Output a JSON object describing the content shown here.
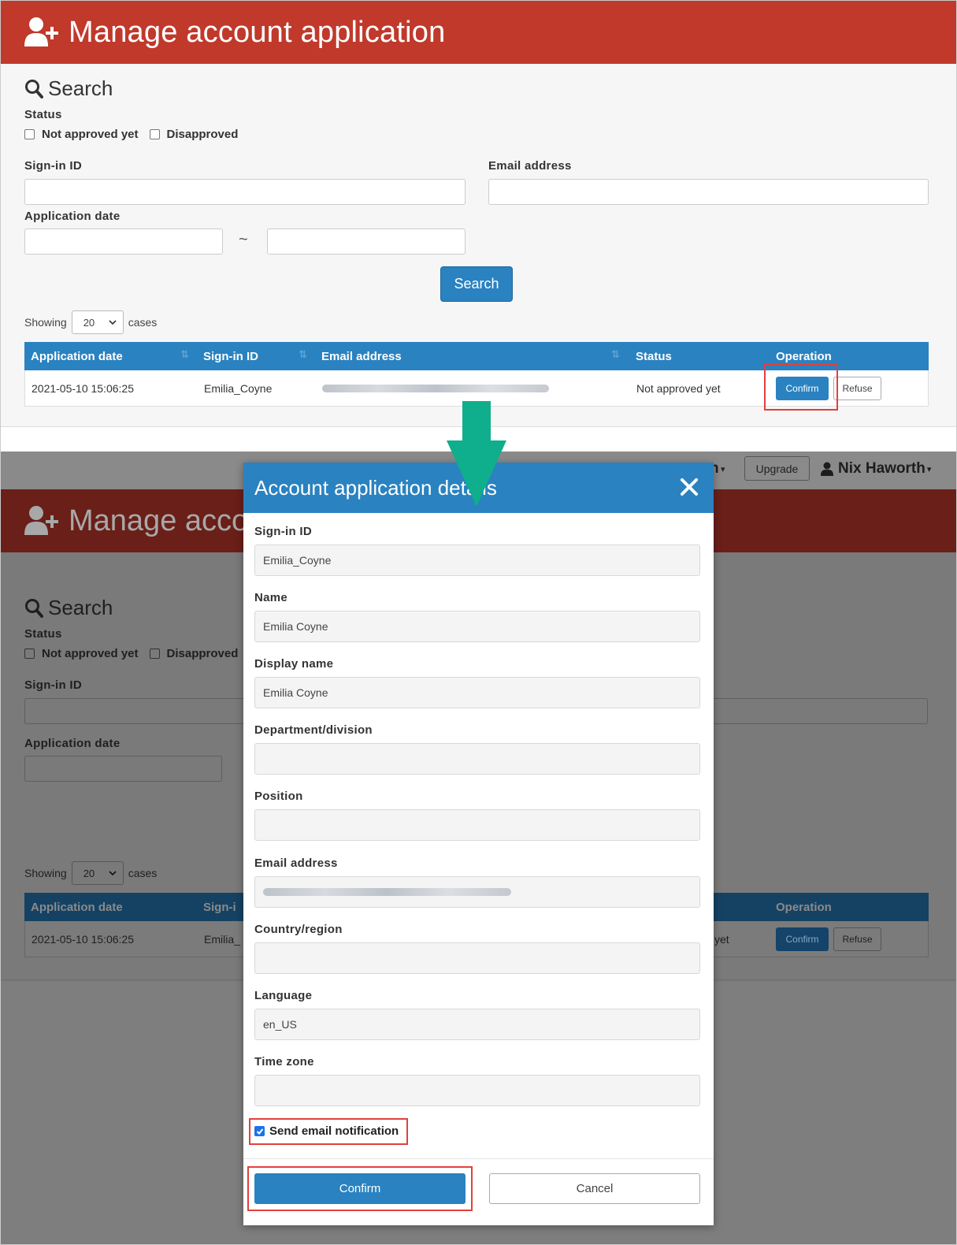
{
  "page": {
    "title": "Manage account application"
  },
  "search": {
    "title": "Search",
    "status_label": "Status",
    "status_options": [
      "Not approved yet",
      "Disapproved"
    ],
    "signin_label": "Sign-in ID",
    "email_label": "Email address",
    "date_label": "Application date",
    "date_separator": "~",
    "button": "Search"
  },
  "pagination": {
    "showing": "Showing",
    "page_size": "20",
    "cases": "cases"
  },
  "table": {
    "columns": [
      "Application date",
      "Sign-in ID",
      "Email address",
      "Status",
      "Operation"
    ],
    "rows": [
      {
        "date": "2021-05-10 15:06:25",
        "signin": "Emilia_Coyne",
        "status": "Not approved yet",
        "confirm": "Confirm",
        "refuse": "Refuse"
      }
    ]
  },
  "navbar": {
    "upgrade": "Upgrade",
    "user": "Nix Haworth",
    "partial_menu": "n"
  },
  "background": {
    "partial_title": "Manage acco",
    "partial_signin_header": "Sign-i",
    "partial_signin_value": "Emilia_",
    "partial_status": "yet",
    "partial_disapproved": "Disapproved"
  },
  "modal": {
    "title": "Account application details",
    "fields": [
      {
        "label": "Sign-in ID",
        "value": "Emilia_Coyne"
      },
      {
        "label": "Name",
        "value": "Emilia Coyne"
      },
      {
        "label": "Display name",
        "value": "Emilia Coyne"
      },
      {
        "label": "Department/division",
        "value": ""
      },
      {
        "label": "Position",
        "value": ""
      },
      {
        "label": "Email address",
        "value": ""
      },
      {
        "label": "Country/region",
        "value": ""
      },
      {
        "label": "Language",
        "value": "en_US"
      },
      {
        "label": "Time zone",
        "value": ""
      }
    ],
    "send_email_label": "Send email notification",
    "confirm": "Confirm",
    "cancel": "Cancel"
  },
  "colors": {
    "header_red": "#c0392b",
    "primary_blue": "#2a82c0",
    "highlight_red": "#e0413c",
    "arrow_green": "#0fae8c"
  }
}
